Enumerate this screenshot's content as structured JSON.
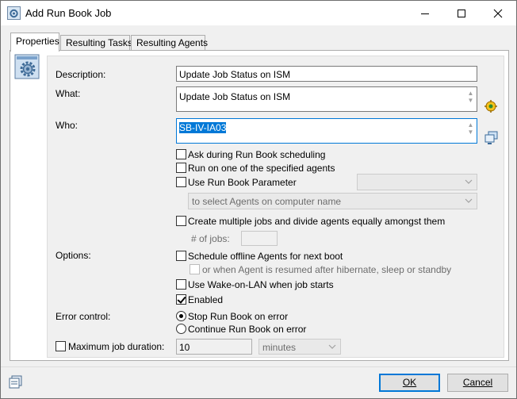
{
  "window": {
    "title": "Add Run Book Job",
    "controls": {
      "minimize": "minimize",
      "maximize": "maximize",
      "close": "close"
    }
  },
  "tabs": [
    {
      "label": "Properties",
      "active": true
    },
    {
      "label": "Resulting Tasks",
      "active": false
    },
    {
      "label": "Resulting Agents",
      "active": false
    }
  ],
  "form": {
    "description_label": "Description:",
    "description_value": "Update Job Status on ISM",
    "what_label": "What:",
    "what_value": "Update Job Status on ISM",
    "who_label": "Who:",
    "who_value": "SB-IV-IA03",
    "ask_during_scheduling": {
      "label": "Ask during Run Book scheduling",
      "checked": false
    },
    "run_on_one_agent": {
      "label": "Run on one of the specified agents",
      "checked": false
    },
    "use_parameter": {
      "label": "Use Run Book Parameter",
      "checked": false,
      "value": ""
    },
    "select_agents_combo": "to select Agents on computer name",
    "create_multiple_jobs": {
      "label": "Create multiple jobs and divide agents equally amongst them",
      "checked": false
    },
    "num_jobs_label": "# of jobs:",
    "num_jobs_value": "",
    "options_label": "Options:",
    "schedule_offline": {
      "label": "Schedule offline Agents for next boot",
      "checked": false
    },
    "resume_after_hibernate": {
      "label": "or when Agent is resumed after hibernate, sleep or standby",
      "checked": false
    },
    "wake_on_lan": {
      "label": "Use Wake-on-LAN when job starts",
      "checked": false
    },
    "enabled": {
      "label": "Enabled",
      "checked": true
    },
    "error_control_label": "Error control:",
    "stop_on_error": {
      "label": "Stop Run Book on error",
      "selected": true
    },
    "continue_on_error": {
      "label": "Continue Run Book on error",
      "selected": false
    },
    "max_duration": {
      "label": "Maximum job duration:",
      "checked": false,
      "value": "10",
      "unit": "minutes"
    }
  },
  "buttons": {
    "ok": "OK",
    "cancel": "Cancel"
  },
  "icons": {
    "title": "gear-window-icon",
    "properties": "gear-properties-icon",
    "what_picker": "task-picker-icon",
    "who_picker": "agents-picker-icon",
    "bottom": "window-list-icon"
  },
  "colors": {
    "accent": "#0078d7",
    "window_bg": "#f0f0f0",
    "panel_bg": "#ffffff"
  }
}
